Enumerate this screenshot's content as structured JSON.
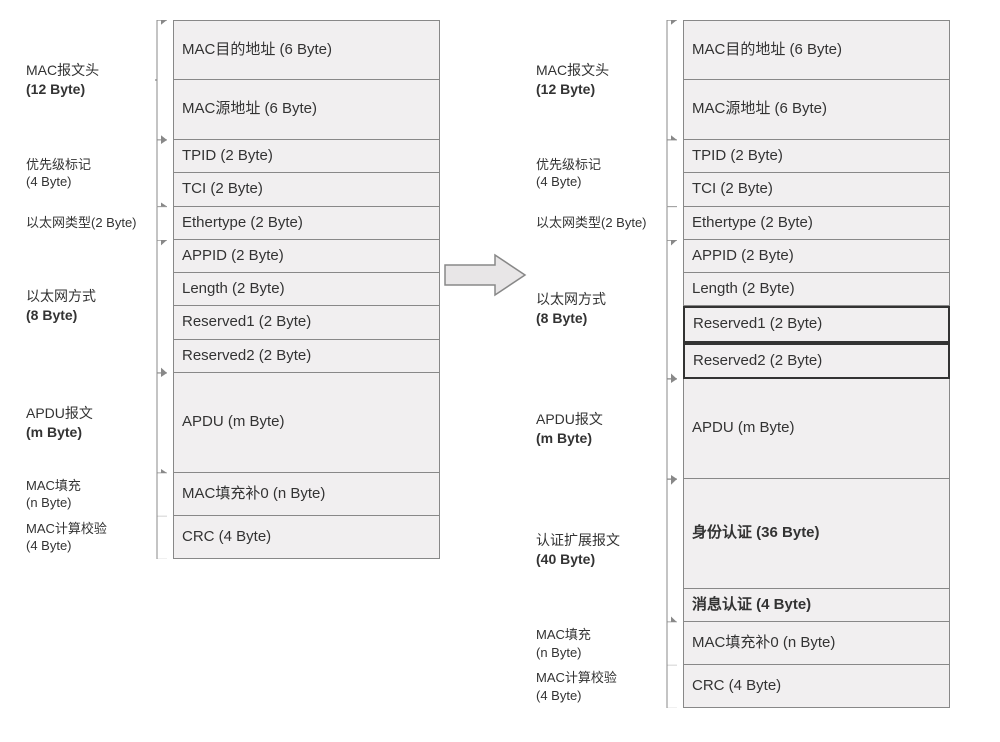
{
  "left": {
    "sections": [
      {
        "label1": "MAC报文头",
        "label2": "(12 Byte)",
        "rows": [
          {
            "text": "MAC目的地址 (6 Byte)",
            "style": "tall"
          },
          {
            "text": "MAC源地址 (6 Byte)",
            "style": "tall stack"
          }
        ]
      },
      {
        "label1": "优先级标记",
        "label2": "(4 Byte)",
        "small": true,
        "rows": [
          {
            "text": "TPID (2 Byte)",
            "style": "stack"
          },
          {
            "text": "TCI (2 Byte)",
            "style": "stack"
          }
        ]
      },
      {
        "label1": "以太网类型(2 Byte)",
        "label2": "",
        "small": true,
        "rows": [
          {
            "text": "Ethertype (2 Byte)",
            "style": "stack"
          }
        ]
      },
      {
        "label1": "以太网方式",
        "label2": "(8 Byte)",
        "rows": [
          {
            "text": "APPID (2 Byte)",
            "style": "stack"
          },
          {
            "text": "Length (2 Byte)",
            "style": "stack"
          },
          {
            "text": "Reserved1 (2 Byte)",
            "style": "stack"
          },
          {
            "text": "Reserved2 (2 Byte)",
            "style": "stack"
          }
        ]
      },
      {
        "label1": "APDU报文",
        "label2": "(m Byte)",
        "rows": [
          {
            "text": "APDU (m Byte)",
            "style": "stack apdu"
          }
        ]
      },
      {
        "label1": "MAC填充",
        "label2": "(n Byte)",
        "small": true,
        "rows": [
          {
            "text": "MAC填充补0  (n Byte)",
            "style": "stack"
          }
        ]
      },
      {
        "label1": "MAC计算校验",
        "label2": "(4 Byte)",
        "small": true,
        "rows": [
          {
            "text": "CRC (4 Byte)",
            "style": "stack"
          }
        ]
      }
    ]
  },
  "right": {
    "sections": [
      {
        "label1": "MAC报文头",
        "label2": "(12 Byte)",
        "rows": [
          {
            "text": "MAC目的地址 (6 Byte)",
            "style": "tall"
          },
          {
            "text": "MAC源地址 (6 Byte)",
            "style": "tall stack"
          }
        ]
      },
      {
        "label1": "优先级标记",
        "label2": "(4 Byte)",
        "small": true,
        "rows": [
          {
            "text": "TPID (2 Byte)",
            "style": "stack"
          },
          {
            "text": "TCI (2 Byte)",
            "style": "stack"
          }
        ]
      },
      {
        "label1": "以太网类型(2 Byte)",
        "label2": "",
        "small": true,
        "rows": [
          {
            "text": "Ethertype (2 Byte)",
            "style": "stack"
          }
        ]
      },
      {
        "label1": "以太网方式",
        "label2": "(8 Byte)",
        "rows": [
          {
            "text": "APPID (2 Byte)",
            "style": "stack"
          },
          {
            "text": "Length (2 Byte)",
            "style": "stack"
          },
          {
            "text": "Reserved1 (2 Byte)",
            "style": "stack hl"
          },
          {
            "text": "Reserved2 (2 Byte)",
            "style": "stack hl"
          }
        ]
      },
      {
        "label1": "APDU报文",
        "label2": "(m Byte)",
        "rows": [
          {
            "text": "APDU (m Byte)",
            "style": "stack apdu"
          }
        ]
      },
      {
        "label1": "认证扩展报文",
        "label2": "(40 Byte)",
        "bold": true,
        "rows": [
          {
            "text": "身份认证 (36 Byte)",
            "style": "stack auth bold"
          },
          {
            "text": "消息认证 (4 Byte)",
            "style": "stack bold"
          }
        ]
      },
      {
        "label1": "MAC填充",
        "label2": "(n Byte)",
        "small": true,
        "rows": [
          {
            "text": "MAC填充补0  (n Byte)",
            "style": "stack"
          }
        ]
      },
      {
        "label1": "MAC计算校验",
        "label2": "(4 Byte)",
        "small": true,
        "rows": [
          {
            "text": "CRC (4 Byte)",
            "style": "stack"
          }
        ]
      }
    ]
  }
}
